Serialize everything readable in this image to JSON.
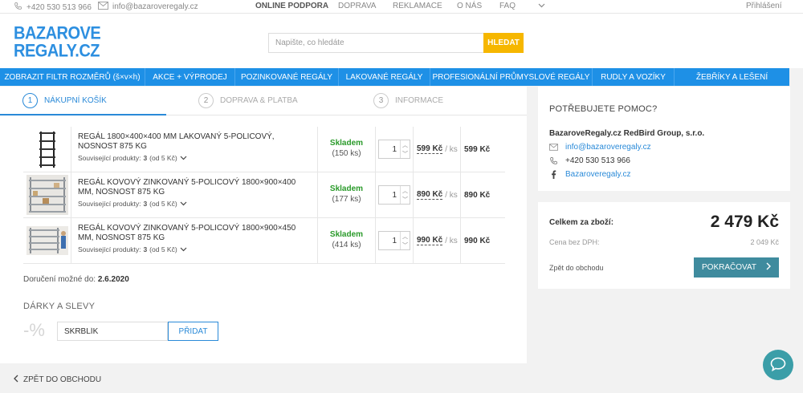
{
  "topbar": {
    "phone": "+420 530 513 966",
    "email": "info@bazaroveregaly.cz",
    "nav": [
      "ONLINE PODPORA",
      "DOPRAVA",
      "REKLAMACE",
      "O NÁS",
      "FAQ"
    ],
    "login": "Přihlášení"
  },
  "header": {
    "logo_line1": "BAZAROVE",
    "logo_line2": "REGALY.CZ",
    "search_placeholder": "Napište, co hledáte",
    "search_button": "HLEDAT"
  },
  "categories": [
    "ZOBRAZIT FILTR ROZMĚRŮ (š×v×h)",
    "AKCE + VÝPRODEJ",
    "POZINKOVANÉ REGÁLY",
    "LAKOVANÉ REGÁLY",
    "PROFESIONÁLNÍ PRŮMYSLOVÉ REGÁLY",
    "RUDLY A VOZÍKY",
    "ŽEBŘÍKY A LEŠENÍ"
  ],
  "steps": [
    {
      "num": "1",
      "label": "NÁKUPNÍ KOŠÍK"
    },
    {
      "num": "2",
      "label": "DOPRAVA & PLATBA"
    },
    {
      "num": "3",
      "label": "INFORMACE"
    }
  ],
  "cart": [
    {
      "name": "REGÁL 1800×400×400 MM LAKOVANÝ 5-POLICOVÝ, NOSNOST 875 KG",
      "related_label": "Související produkty:",
      "related_count": "3",
      "related_extra": "(od 5 Kč)",
      "stock": "Skladem",
      "stock_count": "(150 ks)",
      "qty": "1",
      "unit_price": "599 Kč",
      "unit": "/ ks",
      "total": "599 Kč"
    },
    {
      "name": "REGÁL KOVOVÝ ZINKOVANÝ 5-POLICOVÝ 1800×900×400 MM, NOSNOST 875 KG",
      "related_label": "Související produkty:",
      "related_count": "3",
      "related_extra": "(od 5 Kč)",
      "stock": "Skladem",
      "stock_count": "(177 ks)",
      "qty": "1",
      "unit_price": "890 Kč",
      "unit": "/ ks",
      "total": "890 Kč"
    },
    {
      "name": "REGÁL KOVOVÝ ZINKOVANÝ 5-POLICOVÝ 1800×900×450 MM, NOSNOST 875 KG",
      "related_label": "Související produkty:",
      "related_count": "3",
      "related_extra": "(od 5 Kč)",
      "stock": "Skladem",
      "stock_count": "(414 ks)",
      "qty": "1",
      "unit_price": "990 Kč",
      "unit": "/ ks",
      "total": "990 Kč"
    }
  ],
  "delivery": {
    "label": "Doručení možné do:",
    "date": "2.6.2020"
  },
  "gifts": {
    "title": "DÁRKY A SLEVY",
    "percent": "-%",
    "coupon_value": "SKRBLÍK",
    "apply": "PŘIDAT"
  },
  "back_link": "ZPĚT DO OBCHODU",
  "help": {
    "title": "POTŘEBUJETE POMOC?",
    "company": "BazaroveRegaly.cz RedBird Group, s.r.o.",
    "email": "info@bazaroveregaly.cz",
    "phone": "+420 530 513 966",
    "facebook": "Bazaroveregaly.cz"
  },
  "summary": {
    "total_label": "Celkem za zboží:",
    "total_value": "2 479 Kč",
    "novat_label": "Cena bez DPH:",
    "novat_value": "2 049 Kč",
    "back_label": "Zpět do obchodu",
    "continue": "POKRAČOVAT"
  },
  "colors": {
    "brand_blue": "#1e90e6",
    "search_yellow": "#f6b700",
    "stock_green": "#2a9a2a",
    "continue_teal": "#3f8b9e",
    "chat_teal": "#3b9ea8"
  }
}
